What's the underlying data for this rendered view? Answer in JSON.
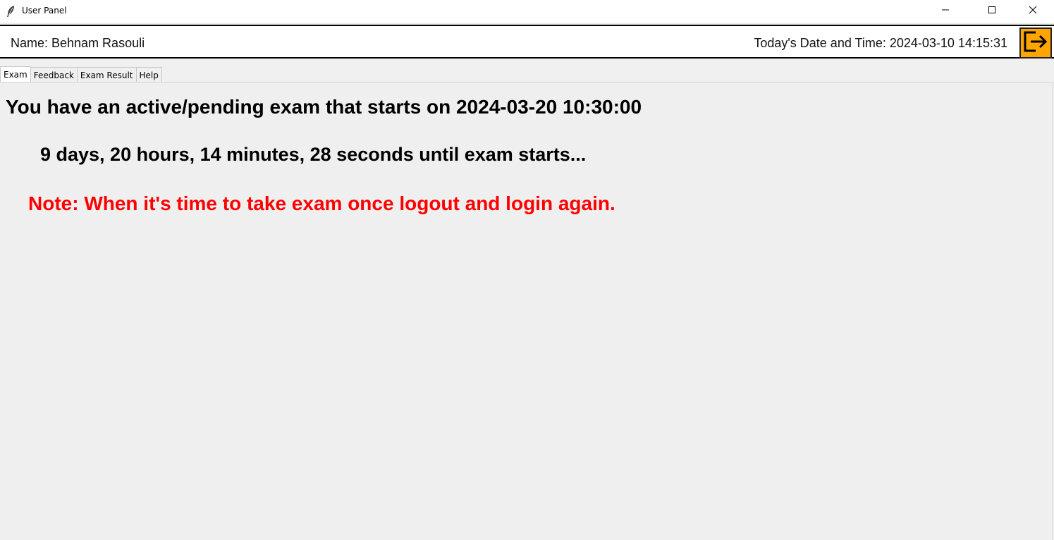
{
  "window": {
    "title": "User Panel",
    "icon": "feather-icon",
    "controls": [
      "minimize-icon",
      "maximize-icon",
      "close-icon"
    ]
  },
  "header": {
    "name_label": "Name: Behnam Rasouli",
    "datetime_label": "Today's Date and Time: 2024-03-10 14:15:31",
    "logout_icon": "logout-icon",
    "logout_color": "#ffa500"
  },
  "tabs": [
    {
      "label": "Exam",
      "active": true
    },
    {
      "label": "Feedback",
      "active": false
    },
    {
      "label": "Exam Result",
      "active": false
    },
    {
      "label": "Help",
      "active": false
    }
  ],
  "exam": {
    "status_text": "You have an active/pending exam that starts on 2024-03-20 10:30:00",
    "countdown_text": "9 days, 20 hours, 14 minutes, 28 seconds until exam starts...",
    "note_text": "Note: When it's time to take exam once logout and login again.",
    "note_color": "#ff0000"
  }
}
